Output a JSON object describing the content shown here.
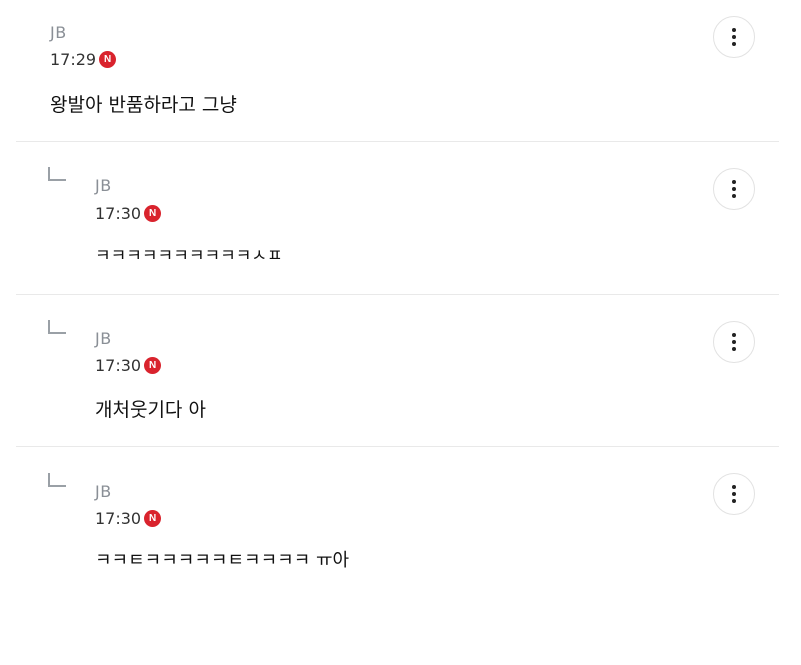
{
  "comments": [
    {
      "author": "JB",
      "time": "17:29",
      "badge": "N",
      "text": "왕발아 반품하라고 그냥",
      "is_reply": false
    },
    {
      "author": "JB",
      "time": "17:30",
      "badge": "N",
      "text": "ㅋㅋㅋㅋㅋㅋㅋㅋㅋㅋㅅㅍ",
      "is_reply": true
    },
    {
      "author": "JB",
      "time": "17:30",
      "badge": "N",
      "text": "개처웃기다 아",
      "is_reply": true
    },
    {
      "author": "JB",
      "time": "17:30",
      "badge": "N",
      "text": "ㅋㅋㅌㅋㅋㅋㅋㅋㅌㅋㅋㅋㅋ ㅠ아",
      "is_reply": true
    }
  ],
  "icons": {
    "more": "more-vertical-icon",
    "reply": "reply-arrow-icon",
    "new": "new-badge"
  },
  "colors": {
    "new_badge": "#d9232d",
    "author": "#8a8f96",
    "divider": "#e9e9e9"
  }
}
